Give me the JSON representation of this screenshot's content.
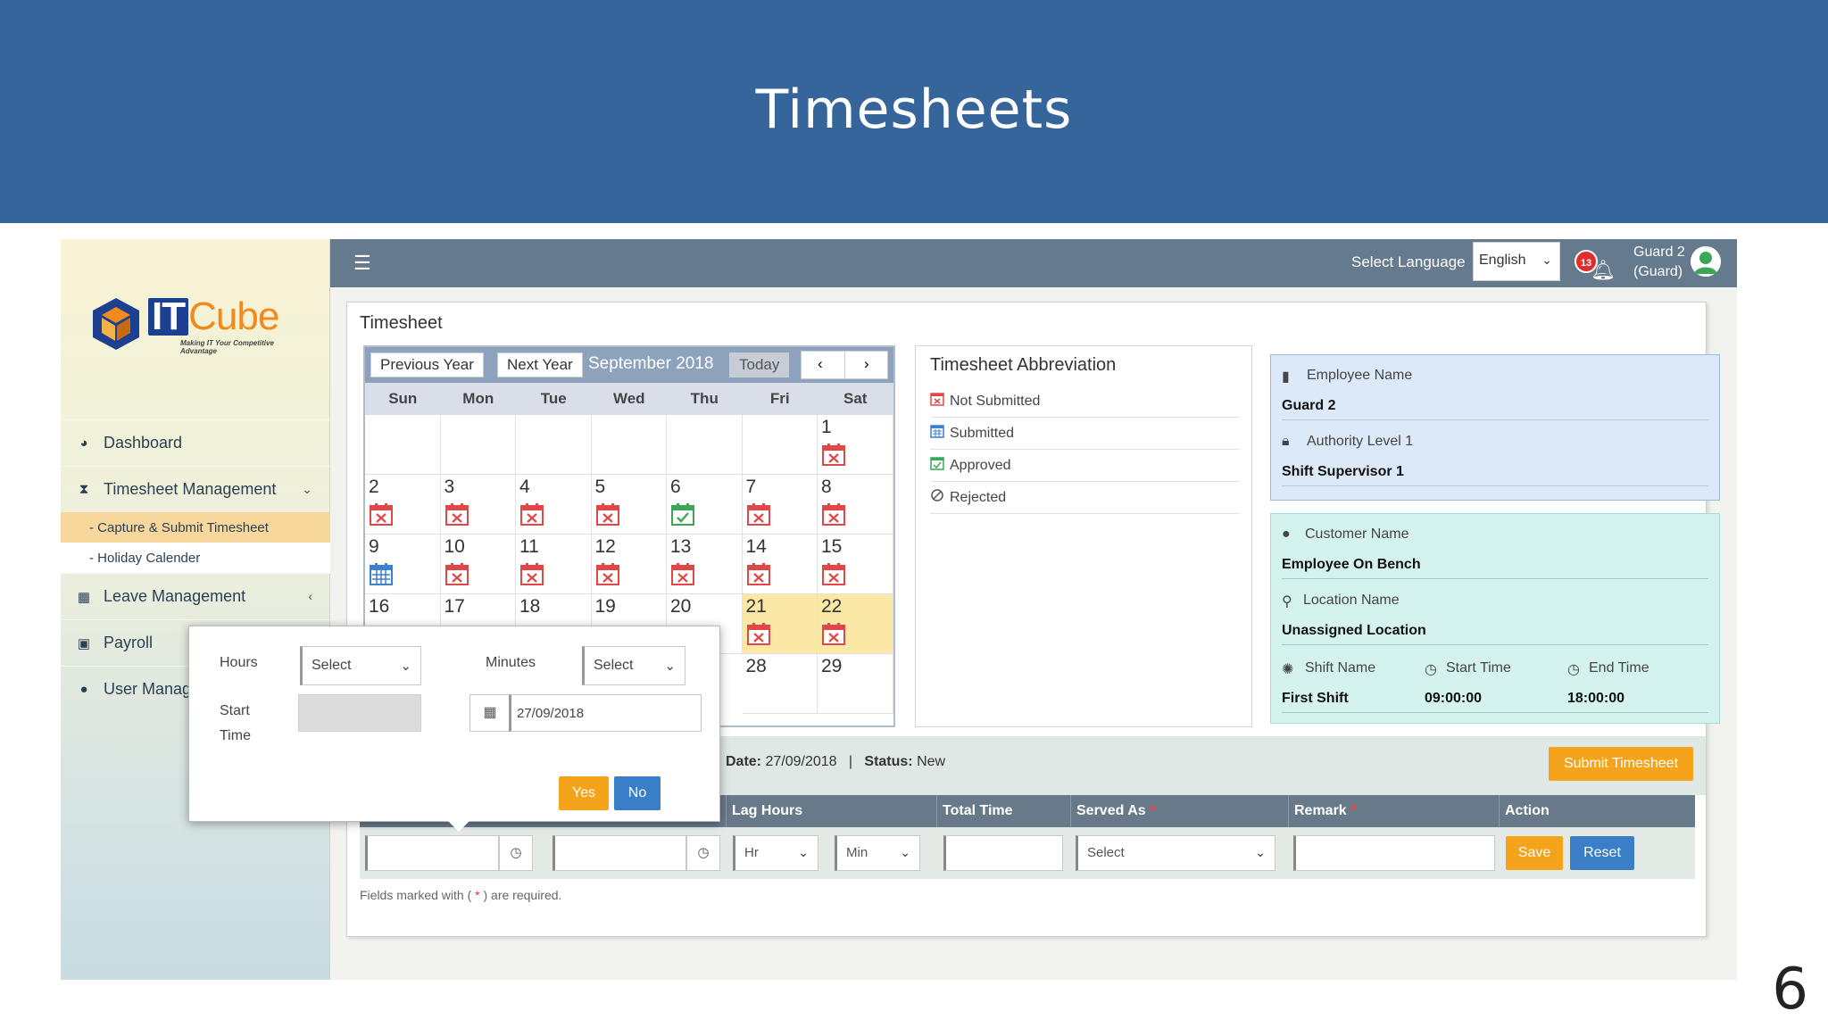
{
  "slide": {
    "title": "Timesheets",
    "page_number": "6"
  },
  "app": {
    "logo": {
      "brand_it": "IT",
      "brand_cube": "Cube",
      "tagline": "Making IT Your Competitive Advantage"
    },
    "topbar": {
      "select_language_label": "Select Language",
      "language_value": "English",
      "notification_count": "13",
      "user_name": "Guard 2",
      "user_role": "(Guard)"
    },
    "sidebar": {
      "dashboard": "Dashboard",
      "timesheet_management": "Timesheet Management",
      "capture_submit": "- Capture & Submit Timesheet",
      "holiday_calender": "- Holiday Calender",
      "leave_management": "Leave Management",
      "payroll": "Payroll",
      "user_management": "User Manag"
    },
    "panel_title": "Timesheet",
    "calendar": {
      "prev_year": "Previous Year",
      "next_year": "Next Year",
      "month_label": "September 2018",
      "today": "Today",
      "prev_icon": "‹",
      "next_icon": "›",
      "weekdays": [
        "Sun",
        "Mon",
        "Tue",
        "Wed",
        "Thu",
        "Fri",
        "Sat"
      ],
      "days": [
        {
          "d": "1",
          "s": "not_submitted"
        },
        {
          "d": "2",
          "s": "not_submitted"
        },
        {
          "d": "3",
          "s": "not_submitted"
        },
        {
          "d": "4",
          "s": "not_submitted"
        },
        {
          "d": "5",
          "s": "not_submitted"
        },
        {
          "d": "6",
          "s": "approved"
        },
        {
          "d": "7",
          "s": "not_submitted"
        },
        {
          "d": "8",
          "s": "not_submitted"
        },
        {
          "d": "9",
          "s": "submitted"
        },
        {
          "d": "10",
          "s": "not_submitted"
        },
        {
          "d": "11",
          "s": "not_submitted"
        },
        {
          "d": "12",
          "s": "not_submitted"
        },
        {
          "d": "13",
          "s": "not_submitted"
        },
        {
          "d": "14",
          "s": "not_submitted"
        },
        {
          "d": "15",
          "s": "not_submitted"
        },
        {
          "d": "16",
          "s": ""
        },
        {
          "d": "17",
          "s": ""
        },
        {
          "d": "18",
          "s": ""
        },
        {
          "d": "19",
          "s": ""
        },
        {
          "d": "20",
          "s": ""
        },
        {
          "d": "21",
          "s": "not_submitted"
        },
        {
          "d": "22",
          "s": "not_submitted"
        },
        {
          "d": "28",
          "s": ""
        },
        {
          "d": "29",
          "s": ""
        }
      ]
    },
    "abbreviation": {
      "title": "Timesheet Abbreviation",
      "not_submitted": "Not Submitted",
      "submitted": "Submitted",
      "approved": "Approved",
      "rejected": "Rejected"
    },
    "employee": {
      "employee_name_label": "Employee Name",
      "employee_name": "Guard 2",
      "authority_label": "Authority Level 1",
      "authority_value": "Shift Supervisor 1"
    },
    "customer": {
      "customer_name_label": "Customer Name",
      "customer_name": "Employee On Bench",
      "location_label": "Location Name",
      "location_value": "Unassigned Location",
      "shift_name_label": "Shift Name",
      "start_time_label": "Start Time",
      "end_time_label": "End Time",
      "shift_name": "First Shift",
      "start_time": "09:00:00",
      "end_time": "18:00:00"
    },
    "info": {
      "date_label": "Date:",
      "date_value": "27/09/2018",
      "separator": "|",
      "status_label": "Status:",
      "status_value": "New",
      "submit_button": "Submit Timesheet"
    },
    "table": {
      "lag_hours": "Lag Hours",
      "total_time": "Total Time",
      "served_as": "Served As",
      "remark": "Remark",
      "action": "Action",
      "required_mark": "*",
      "hr_placeholder": "Hr",
      "min_placeholder": "Min",
      "select_placeholder": "Select",
      "save_button": "Save",
      "reset_button": "Reset",
      "note_before": "Fields marked with (",
      "note_mark": "*",
      "note_after": ") are required."
    },
    "popup": {
      "hours_label": "Hours",
      "hours_value": "Select",
      "minutes_label": "Minutes",
      "minutes_value": "Select",
      "start_label": "Start",
      "time_label": "Time",
      "date_value": "27/09/2018",
      "yes_button": "Yes",
      "no_button": "No"
    }
  }
}
